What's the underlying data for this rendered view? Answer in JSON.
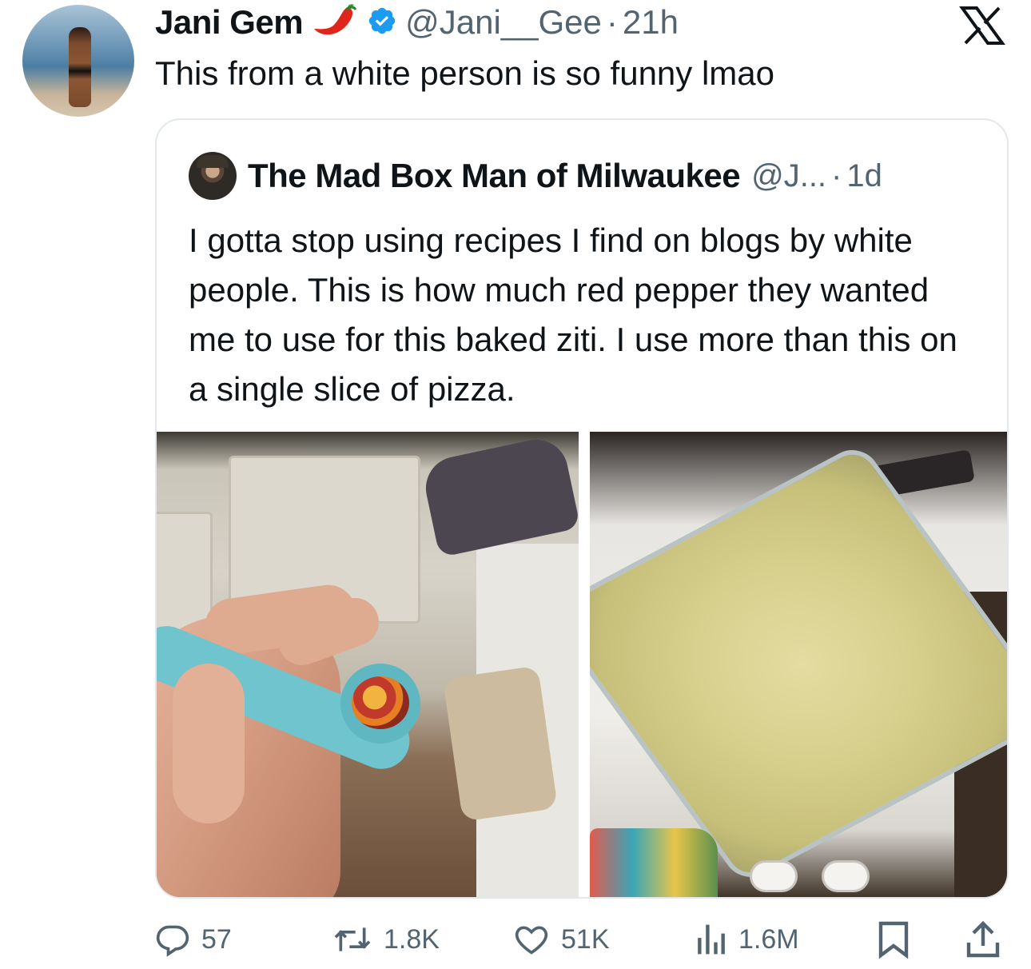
{
  "author": {
    "display_name": "Jani Gem",
    "handle": "@Jani__Gee",
    "separator": "·",
    "time": "21h"
  },
  "tweet": {
    "text": "This from a white person is so funny lmao"
  },
  "quoted": {
    "display_name": "The Mad Box Man of Milwaukee",
    "handle": "@J...",
    "separator": "·",
    "time": "1d",
    "text": "I gotta stop using recipes I find on blogs by white people. This is how much red pepper they wanted me to use for this baked ziti. I use more than this on a single slice of pizza."
  },
  "actions": {
    "replies": "57",
    "reposts": "1.8K",
    "likes": "51K",
    "views": "1.6M"
  },
  "colors": {
    "text": "#0f1419",
    "secondary": "#536471",
    "verified": "#1d9bf0",
    "border": "#e3e8ec"
  },
  "icons": [
    "chili-pepper-emoji",
    "verified-badge-icon",
    "x-logo-icon",
    "reply-icon",
    "repost-icon",
    "like-icon",
    "views-icon",
    "bookmark-icon",
    "share-icon"
  ]
}
